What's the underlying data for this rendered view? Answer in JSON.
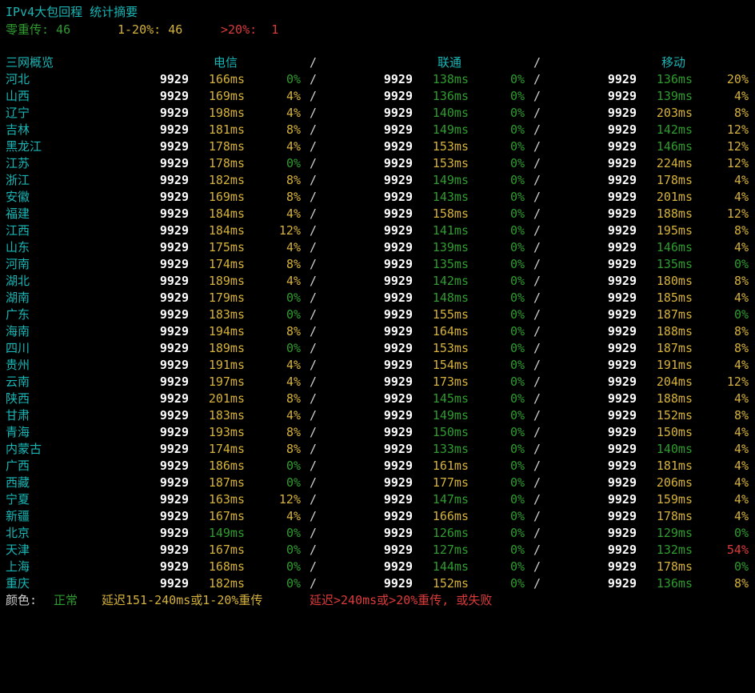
{
  "title": "IPv4大包回程 统计摘要",
  "summary": {
    "zero_label": "零重传: 46",
    "mid_label": "1-20%: 46",
    "high_label": ">20%:  1"
  },
  "header": {
    "overview": "三网概览",
    "telecom": "电信",
    "unicom": "联通",
    "mobile": "移动",
    "slash": "/"
  },
  "colors": {
    "cyan": "#19b6b6",
    "green": "#2e9c2e",
    "yellow": "#d6b23a",
    "red": "#dd3a3a"
  },
  "rows": [
    {
      "name": "河北",
      "t": [
        "9929",
        "166ms",
        "0%"
      ],
      "u": [
        "9929",
        "138ms",
        "0%"
      ],
      "m": [
        "9929",
        "136ms",
        "20%"
      ],
      "c": [
        "y",
        "g",
        "g",
        "g",
        "g",
        "y"
      ]
    },
    {
      "name": "山西",
      "t": [
        "9929",
        "169ms",
        "4%"
      ],
      "u": [
        "9929",
        "136ms",
        "0%"
      ],
      "m": [
        "9929",
        "139ms",
        "4%"
      ],
      "c": [
        "y",
        "y",
        "g",
        "g",
        "g",
        "y"
      ]
    },
    {
      "name": "辽宁",
      "t": [
        "9929",
        "198ms",
        "4%"
      ],
      "u": [
        "9929",
        "140ms",
        "0%"
      ],
      "m": [
        "9929",
        "203ms",
        "8%"
      ],
      "c": [
        "y",
        "y",
        "g",
        "g",
        "y",
        "y"
      ]
    },
    {
      "name": "吉林",
      "t": [
        "9929",
        "181ms",
        "8%"
      ],
      "u": [
        "9929",
        "149ms",
        "0%"
      ],
      "m": [
        "9929",
        "142ms",
        "12%"
      ],
      "c": [
        "y",
        "y",
        "g",
        "g",
        "g",
        "y"
      ]
    },
    {
      "name": "黑龙江",
      "t": [
        "9929",
        "178ms",
        "4%"
      ],
      "u": [
        "9929",
        "153ms",
        "0%"
      ],
      "m": [
        "9929",
        "146ms",
        "12%"
      ],
      "c": [
        "y",
        "y",
        "y",
        "g",
        "g",
        "y"
      ]
    },
    {
      "name": "江苏",
      "t": [
        "9929",
        "178ms",
        "0%"
      ],
      "u": [
        "9929",
        "153ms",
        "0%"
      ],
      "m": [
        "9929",
        "224ms",
        "12%"
      ],
      "c": [
        "y",
        "g",
        "y",
        "g",
        "y",
        "y"
      ]
    },
    {
      "name": "浙江",
      "t": [
        "9929",
        "182ms",
        "8%"
      ],
      "u": [
        "9929",
        "149ms",
        "0%"
      ],
      "m": [
        "9929",
        "178ms",
        "4%"
      ],
      "c": [
        "y",
        "y",
        "g",
        "g",
        "y",
        "y"
      ]
    },
    {
      "name": "安徽",
      "t": [
        "9929",
        "169ms",
        "8%"
      ],
      "u": [
        "9929",
        "143ms",
        "0%"
      ],
      "m": [
        "9929",
        "201ms",
        "4%"
      ],
      "c": [
        "y",
        "y",
        "g",
        "g",
        "y",
        "y"
      ]
    },
    {
      "name": "福建",
      "t": [
        "9929",
        "184ms",
        "4%"
      ],
      "u": [
        "9929",
        "158ms",
        "0%"
      ],
      "m": [
        "9929",
        "188ms",
        "12%"
      ],
      "c": [
        "y",
        "y",
        "y",
        "g",
        "y",
        "y"
      ]
    },
    {
      "name": "江西",
      "t": [
        "9929",
        "184ms",
        "12%"
      ],
      "u": [
        "9929",
        "141ms",
        "0%"
      ],
      "m": [
        "9929",
        "195ms",
        "8%"
      ],
      "c": [
        "y",
        "y",
        "g",
        "g",
        "y",
        "y"
      ]
    },
    {
      "name": "山东",
      "t": [
        "9929",
        "175ms",
        "4%"
      ],
      "u": [
        "9929",
        "139ms",
        "0%"
      ],
      "m": [
        "9929",
        "146ms",
        "4%"
      ],
      "c": [
        "y",
        "y",
        "g",
        "g",
        "g",
        "y"
      ]
    },
    {
      "name": "河南",
      "t": [
        "9929",
        "174ms",
        "8%"
      ],
      "u": [
        "9929",
        "135ms",
        "0%"
      ],
      "m": [
        "9929",
        "135ms",
        "0%"
      ],
      "c": [
        "y",
        "y",
        "g",
        "g",
        "g",
        "g"
      ]
    },
    {
      "name": "湖北",
      "t": [
        "9929",
        "189ms",
        "4%"
      ],
      "u": [
        "9929",
        "142ms",
        "0%"
      ],
      "m": [
        "9929",
        "180ms",
        "8%"
      ],
      "c": [
        "y",
        "y",
        "g",
        "g",
        "y",
        "y"
      ]
    },
    {
      "name": "湖南",
      "t": [
        "9929",
        "179ms",
        "0%"
      ],
      "u": [
        "9929",
        "148ms",
        "0%"
      ],
      "m": [
        "9929",
        "185ms",
        "4%"
      ],
      "c": [
        "y",
        "g",
        "g",
        "g",
        "y",
        "y"
      ]
    },
    {
      "name": "广东",
      "t": [
        "9929",
        "183ms",
        "0%"
      ],
      "u": [
        "9929",
        "155ms",
        "0%"
      ],
      "m": [
        "9929",
        "187ms",
        "0%"
      ],
      "c": [
        "y",
        "g",
        "y",
        "g",
        "y",
        "g"
      ]
    },
    {
      "name": "海南",
      "t": [
        "9929",
        "194ms",
        "8%"
      ],
      "u": [
        "9929",
        "164ms",
        "0%"
      ],
      "m": [
        "9929",
        "188ms",
        "8%"
      ],
      "c": [
        "y",
        "y",
        "y",
        "g",
        "y",
        "y"
      ]
    },
    {
      "name": "四川",
      "t": [
        "9929",
        "189ms",
        "0%"
      ],
      "u": [
        "9929",
        "153ms",
        "0%"
      ],
      "m": [
        "9929",
        "187ms",
        "8%"
      ],
      "c": [
        "y",
        "g",
        "y",
        "g",
        "y",
        "y"
      ]
    },
    {
      "name": "贵州",
      "t": [
        "9929",
        "191ms",
        "4%"
      ],
      "u": [
        "9929",
        "154ms",
        "0%"
      ],
      "m": [
        "9929",
        "191ms",
        "4%"
      ],
      "c": [
        "y",
        "y",
        "y",
        "g",
        "y",
        "y"
      ]
    },
    {
      "name": "云南",
      "t": [
        "9929",
        "197ms",
        "4%"
      ],
      "u": [
        "9929",
        "173ms",
        "0%"
      ],
      "m": [
        "9929",
        "204ms",
        "12%"
      ],
      "c": [
        "y",
        "y",
        "y",
        "g",
        "y",
        "y"
      ]
    },
    {
      "name": "陕西",
      "t": [
        "9929",
        "201ms",
        "8%"
      ],
      "u": [
        "9929",
        "145ms",
        "0%"
      ],
      "m": [
        "9929",
        "188ms",
        "4%"
      ],
      "c": [
        "y",
        "y",
        "g",
        "g",
        "y",
        "y"
      ]
    },
    {
      "name": "甘肃",
      "t": [
        "9929",
        "183ms",
        "4%"
      ],
      "u": [
        "9929",
        "149ms",
        "0%"
      ],
      "m": [
        "9929",
        "152ms",
        "8%"
      ],
      "c": [
        "y",
        "y",
        "g",
        "g",
        "y",
        "y"
      ]
    },
    {
      "name": "青海",
      "t": [
        "9929",
        "193ms",
        "8%"
      ],
      "u": [
        "9929",
        "150ms",
        "0%"
      ],
      "m": [
        "9929",
        "150ms",
        "4%"
      ],
      "c": [
        "y",
        "y",
        "g",
        "g",
        "y",
        "y"
      ]
    },
    {
      "name": "内蒙古",
      "t": [
        "9929",
        "174ms",
        "8%"
      ],
      "u": [
        "9929",
        "133ms",
        "0%"
      ],
      "m": [
        "9929",
        "140ms",
        "4%"
      ],
      "c": [
        "y",
        "y",
        "g",
        "g",
        "g",
        "y"
      ]
    },
    {
      "name": "广西",
      "t": [
        "9929",
        "186ms",
        "0%"
      ],
      "u": [
        "9929",
        "161ms",
        "0%"
      ],
      "m": [
        "9929",
        "181ms",
        "4%"
      ],
      "c": [
        "y",
        "g",
        "y",
        "g",
        "y",
        "y"
      ]
    },
    {
      "name": "西藏",
      "t": [
        "9929",
        "187ms",
        "0%"
      ],
      "u": [
        "9929",
        "177ms",
        "0%"
      ],
      "m": [
        "9929",
        "206ms",
        "4%"
      ],
      "c": [
        "y",
        "g",
        "y",
        "g",
        "y",
        "y"
      ]
    },
    {
      "name": "宁夏",
      "t": [
        "9929",
        "163ms",
        "12%"
      ],
      "u": [
        "9929",
        "147ms",
        "0%"
      ],
      "m": [
        "9929",
        "159ms",
        "4%"
      ],
      "c": [
        "y",
        "y",
        "g",
        "g",
        "y",
        "y"
      ]
    },
    {
      "name": "新疆",
      "t": [
        "9929",
        "167ms",
        "4%"
      ],
      "u": [
        "9929",
        "166ms",
        "0%"
      ],
      "m": [
        "9929",
        "178ms",
        "4%"
      ],
      "c": [
        "y",
        "y",
        "y",
        "g",
        "y",
        "y"
      ]
    },
    {
      "name": "北京",
      "t": [
        "9929",
        "149ms",
        "0%"
      ],
      "u": [
        "9929",
        "126ms",
        "0%"
      ],
      "m": [
        "9929",
        "129ms",
        "0%"
      ],
      "c": [
        "g",
        "g",
        "g",
        "g",
        "g",
        "g"
      ]
    },
    {
      "name": "天津",
      "t": [
        "9929",
        "167ms",
        "0%"
      ],
      "u": [
        "9929",
        "127ms",
        "0%"
      ],
      "m": [
        "9929",
        "132ms",
        "54%"
      ],
      "c": [
        "y",
        "g",
        "g",
        "g",
        "g",
        "r"
      ]
    },
    {
      "name": "上海",
      "t": [
        "9929",
        "168ms",
        "0%"
      ],
      "u": [
        "9929",
        "144ms",
        "0%"
      ],
      "m": [
        "9929",
        "178ms",
        "0%"
      ],
      "c": [
        "y",
        "g",
        "g",
        "g",
        "y",
        "g"
      ]
    },
    {
      "name": "重庆",
      "t": [
        "9929",
        "182ms",
        "0%"
      ],
      "u": [
        "9929",
        "152ms",
        "0%"
      ],
      "m": [
        "9929",
        "136ms",
        "8%"
      ],
      "c": [
        "y",
        "g",
        "y",
        "g",
        "g",
        "y"
      ]
    }
  ],
  "legend": {
    "label": "颜色:",
    "normal": "正常",
    "warn": "延迟151-240ms或1-20%重传",
    "bad": "延迟>240ms或>20%重传, 或失败"
  }
}
